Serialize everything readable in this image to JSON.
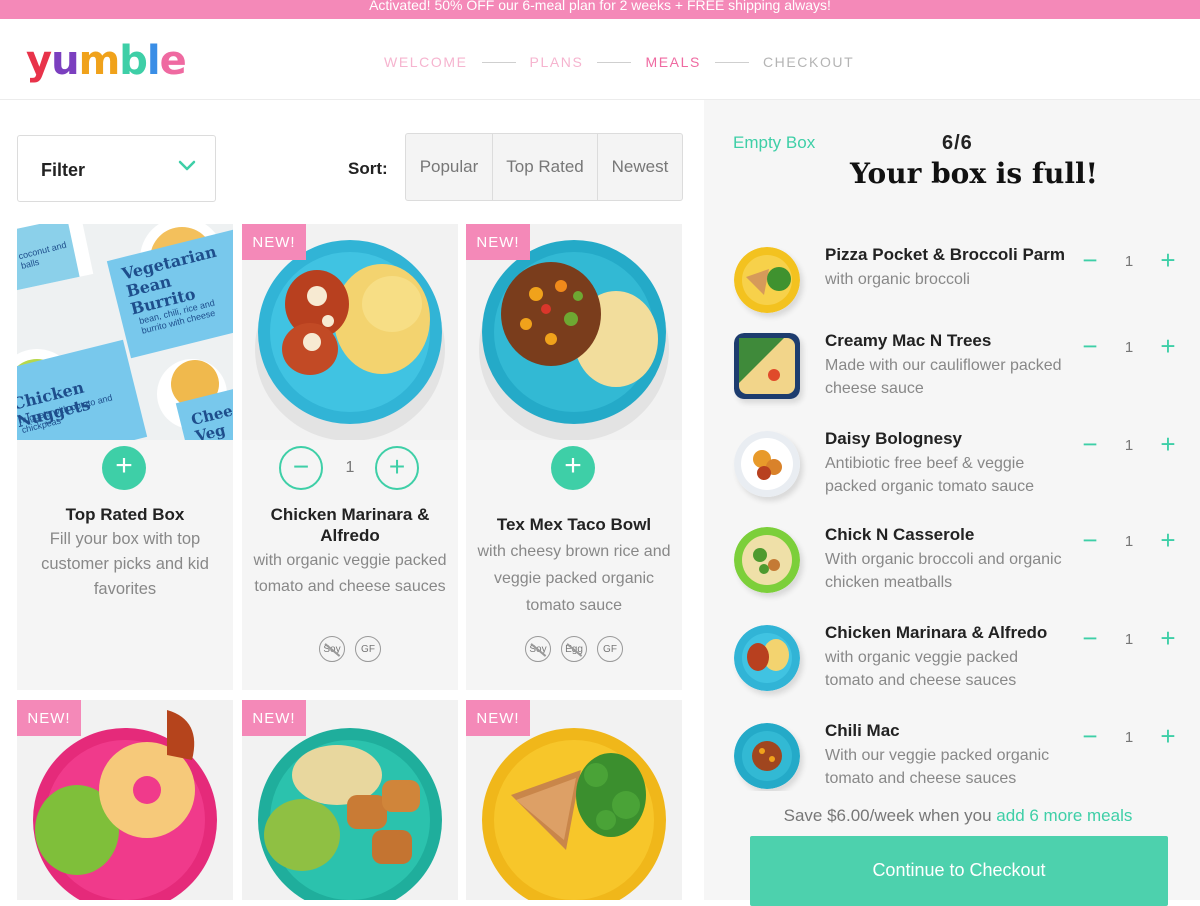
{
  "banner": {
    "text": "Activated! 50% OFF our 6-meal plan for 2 weeks + FREE shipping always!"
  },
  "logo": {
    "letters": [
      "y",
      "u",
      "m",
      "b",
      "l",
      "e"
    ],
    "colors": [
      "#e8334a",
      "#7b3fbf",
      "#f0a21b",
      "#3ecfa7",
      "#3a8ee6",
      "#ef6aa1"
    ]
  },
  "steps": [
    {
      "label": "WELCOME",
      "state": "done"
    },
    {
      "label": "PLANS",
      "state": "done"
    },
    {
      "label": "MEALS",
      "state": "active"
    },
    {
      "label": "CHECKOUT",
      "state": "todo"
    }
  ],
  "filter": {
    "label": "Filter",
    "icon": "chevron-down-icon"
  },
  "sort": {
    "label": "Sort:",
    "options": [
      "Popular",
      "Top Rated",
      "Newest"
    ]
  },
  "cards": [
    {
      "title": "Top Rated Box",
      "desc": "Fill your box with top customer picks and kid favorites",
      "is_new": false,
      "in_box": false,
      "qty": null,
      "badges": [],
      "image": "meal-box-collage",
      "box_labels": [
        "Vegetarian Bean Burrito",
        "bean, chili, rice and burrito with cheese",
        "Chicken Nuggets",
        "nuggets with potato and chickpeas",
        "Chee Veg",
        "coconut and balls"
      ]
    },
    {
      "title": "Chicken Marinara & Alfredo",
      "desc": "with organic veggie packed tomato and cheese sauces",
      "is_new": true,
      "in_box": true,
      "qty": "1",
      "badges": [
        "Soy",
        "GF"
      ],
      "image": "chicken-alfredo-plate"
    },
    {
      "title": "Tex Mex Taco Bowl",
      "desc": "with cheesy brown rice and veggie packed organic tomato sauce",
      "is_new": true,
      "in_box": false,
      "qty": null,
      "badges": [
        "Soy",
        "Egg",
        "GF"
      ],
      "image": "taco-bowl-plate"
    },
    {
      "title": "",
      "desc": "",
      "is_new": true,
      "image": "donut-pink-plate"
    },
    {
      "title": "",
      "desc": "",
      "is_new": true,
      "image": "nuggets-plate"
    },
    {
      "title": "",
      "desc": "",
      "is_new": true,
      "image": "pizza-pocket-plate"
    }
  ],
  "new_tag": "NEW!",
  "add_symbol": "+",
  "minus_symbol": "−",
  "box": {
    "empty_label": "Empty Box",
    "count": "6/6",
    "title": "Your box is full!",
    "items": [
      {
        "name": "Pizza Pocket & Broccoli Parm",
        "desc": "with organic broccoli",
        "qty": "1",
        "image": "pizza-pocket-thumb"
      },
      {
        "name": "Creamy Mac N Trees",
        "desc": "Made with our cauliflower packed cheese sauce",
        "qty": "1",
        "image": "mac-trees-thumb"
      },
      {
        "name": "Daisy Bolognesy",
        "desc": "Antibiotic free beef & veggie packed organic tomato sauce",
        "qty": "1",
        "image": "bolognesy-thumb"
      },
      {
        "name": "Chick N Casserole",
        "desc": "With organic broccoli and organic chicken meatballs",
        "qty": "1",
        "image": "casserole-thumb"
      },
      {
        "name": "Chicken Marinara & Alfredo",
        "desc": "with organic veggie packed tomato and cheese sauces",
        "qty": "1",
        "image": "marinara-thumb"
      },
      {
        "name": "Chili Mac",
        "desc": "With our veggie packed organic tomato and cheese sauces",
        "qty": "1",
        "image": "chili-mac-thumb"
      }
    ],
    "save_prefix": "Save $6.00/week when you ",
    "save_link": "add 6 more meals",
    "checkout_label": "Continue to Checkout"
  },
  "colors": {
    "accent": "#3ecfa7",
    "pink": "#f489b8",
    "active_step": "#ef6aa1"
  }
}
